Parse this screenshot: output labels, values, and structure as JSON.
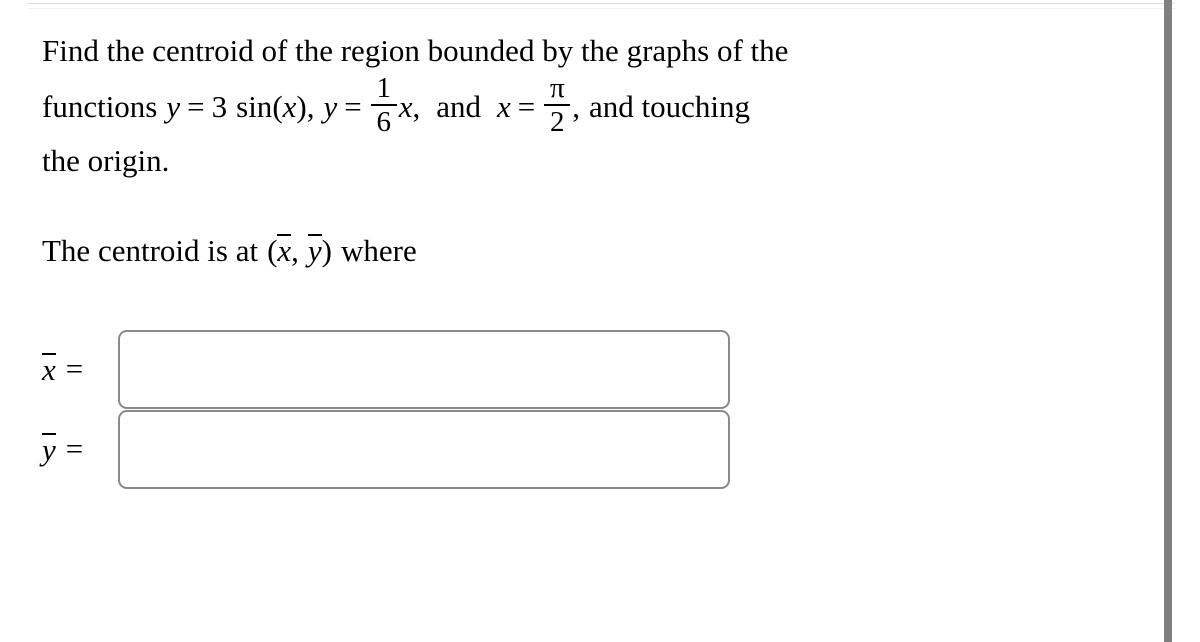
{
  "problem": {
    "line1": "Find the centroid of the region bounded by the graphs of the",
    "line2": {
      "lead": "functions",
      "var_y1": "y",
      "eq1": "=",
      "coef3": "3",
      "sin": "sin",
      "paren_open": "(",
      "var_x_arg": "x",
      "paren_close": ")",
      "comma1": ",",
      "var_y2": "y",
      "eq2": "=",
      "frac_one_sixth_num": "1",
      "frac_one_sixth_den": "6",
      "var_x_mul": "x",
      "comma2": ",",
      "and1": "and",
      "var_x3": "x",
      "eq3": "=",
      "frac_pi_two_num": "π",
      "frac_pi_two_den": "2",
      "comma3": ",",
      "tail": "and touching"
    },
    "line3": "the origin."
  },
  "centroid_statement": {
    "prefix": "The centroid is at",
    "paren_open": "(",
    "xbar": "x",
    "comma": ",",
    "ybar": "y",
    "paren_close": ")",
    "suffix": "where"
  },
  "answers": {
    "xbar": {
      "label_glyph": "x",
      "equals": "=",
      "value": "",
      "placeholder": ""
    },
    "ybar": {
      "label_glyph": "y",
      "equals": "=",
      "value": "",
      "placeholder": ""
    }
  },
  "colors": {
    "background": "#ffffff",
    "text": "#000000",
    "input_border": "#8a8a8a",
    "rule": "#dcdcdc",
    "scrollbar_thumb": "#808080"
  }
}
